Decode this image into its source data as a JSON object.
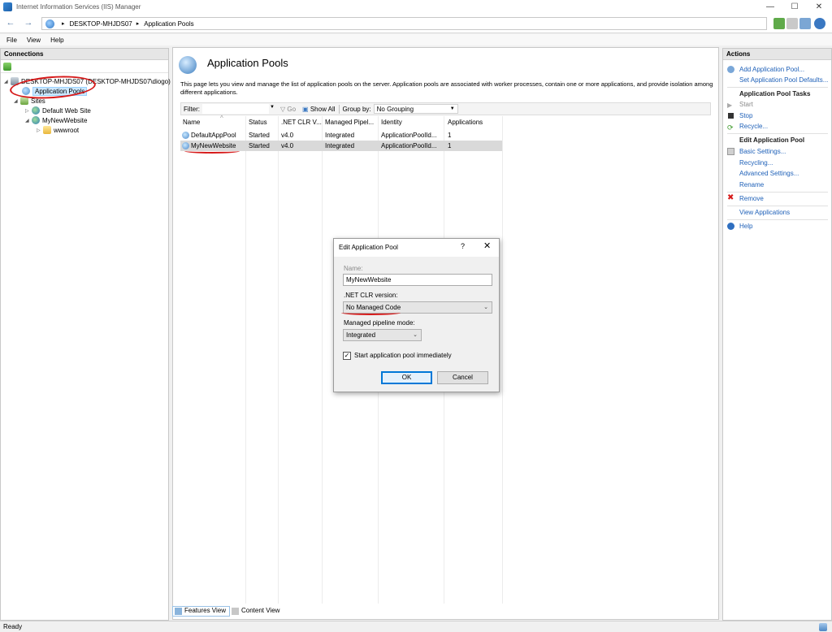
{
  "window": {
    "title": "Internet Information Services (IIS) Manager",
    "minimize": "—",
    "maximize": "☐",
    "close": "✕"
  },
  "address": {
    "back": "←",
    "forward": "→",
    "crumbs": [
      "DESKTOP-MHJDS07",
      "Application Pools"
    ],
    "separator": "▸"
  },
  "menu": {
    "file": "File",
    "view": "View",
    "help": "Help"
  },
  "connections": {
    "header": "Connections",
    "tree": {
      "server": "DESKTOP-MHJDS07 (DESKTOP-MHJDS07\\diogo)",
      "app_pools": "Application Pools",
      "sites": "Sites",
      "default_site": "Default Web Site",
      "my_site": "MyNewWebsite",
      "wwwroot": "wwwroot"
    }
  },
  "center": {
    "title": "Application Pools",
    "description": "This page lets you view and manage the list of application pools on the server. Application pools are associated with worker processes, contain one or more applications, and provide isolation among different applications.",
    "filter": {
      "label": "Filter:",
      "go": "Go",
      "show_all": "Show All",
      "group_by_label": "Group by:",
      "group_by_value": "No Grouping"
    },
    "columns": [
      "Name",
      "Status",
      ".NET CLR V...",
      "Managed Pipel...",
      "Identity",
      "Applications"
    ],
    "rows": [
      [
        "DefaultAppPool",
        "Started",
        "v4.0",
        "Integrated",
        "ApplicationPoolId...",
        "1"
      ],
      [
        "MyNewWebsite",
        "Started",
        "v4.0",
        "Integrated",
        "ApplicationPoolId...",
        "1"
      ]
    ],
    "tabs": {
      "features": "Features View",
      "content": "Content View"
    }
  },
  "actions": {
    "header": "Actions",
    "add_pool": "Add Application Pool...",
    "set_defaults": "Set Application Pool Defaults...",
    "tasks_header": "Application Pool Tasks",
    "start": "Start",
    "stop": "Stop",
    "recycle": "Recycle...",
    "edit_header": "Edit Application Pool",
    "basic_settings": "Basic Settings...",
    "recycling": "Recycling...",
    "advanced_settings": "Advanced Settings...",
    "rename": "Rename",
    "remove": "Remove",
    "view_apps": "View Applications",
    "help": "Help"
  },
  "dialog": {
    "title": "Edit Application Pool",
    "help": "?",
    "close": "✕",
    "name_label": "Name:",
    "name_value": "MyNewWebsite",
    "clr_label": ".NET CLR version:",
    "clr_value": "No Managed Code",
    "pipeline_label": "Managed pipeline mode:",
    "pipeline_value": "Integrated",
    "start_immediately_label": "Start application pool immediately",
    "start_immediately_checked": "✓",
    "ok": "OK",
    "cancel": "Cancel"
  },
  "status": {
    "text": "Ready"
  },
  "colors": {
    "link": "#1e60b8",
    "annotation": "#d61a1a",
    "selection": "#cce8ff"
  }
}
